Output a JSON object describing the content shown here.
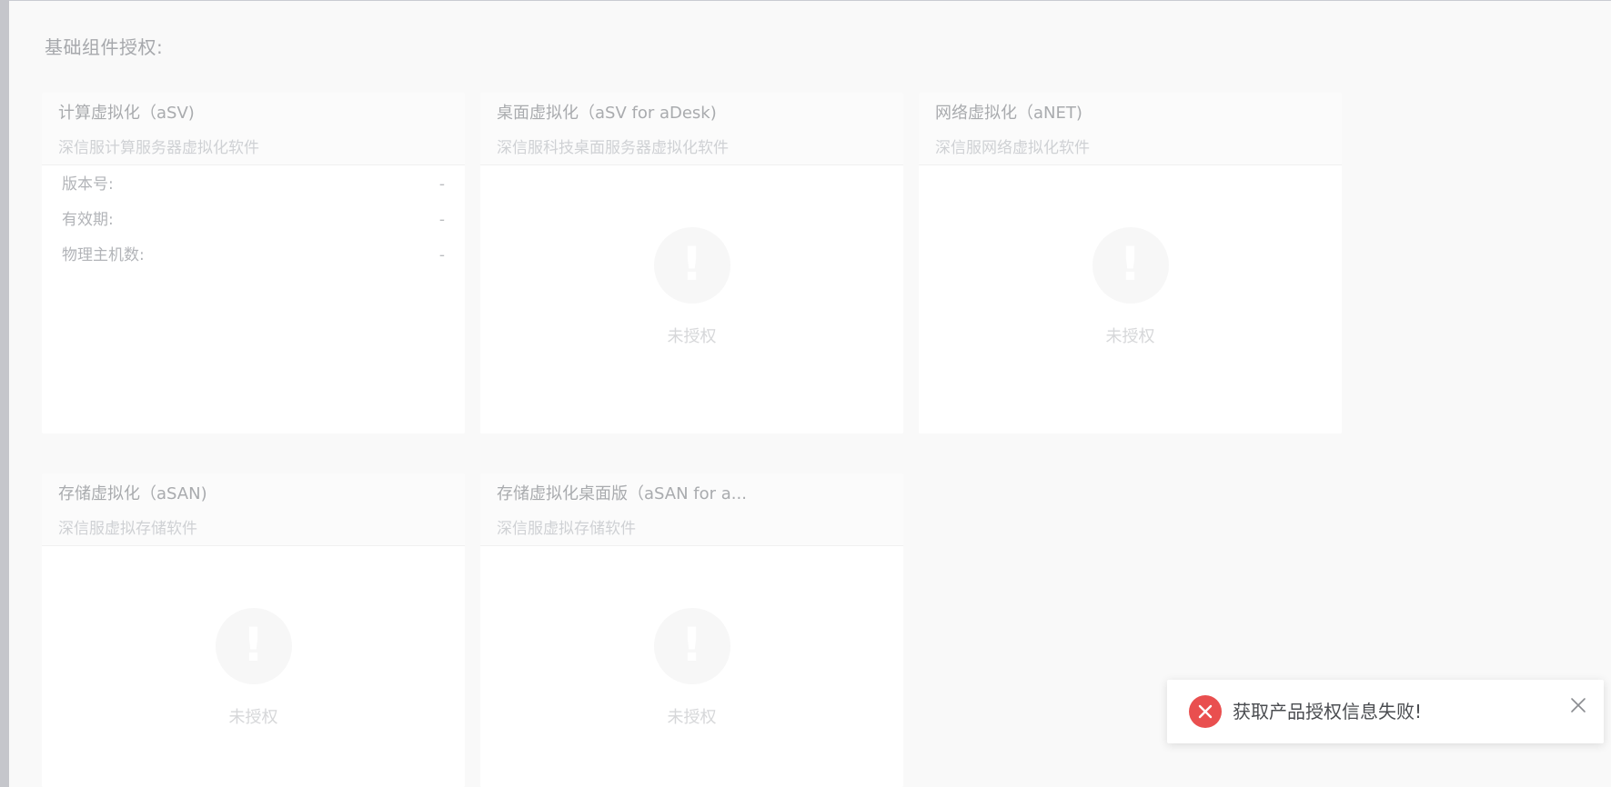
{
  "section": {
    "title": "基础组件授权:"
  },
  "cards": [
    {
      "title": "计算虚拟化（aSV)",
      "subtitle": "深信服计算服务器虚拟化软件",
      "rows": [
        {
          "label": "版本号:",
          "value": "-"
        },
        {
          "label": "有效期:",
          "value": "-"
        },
        {
          "label": "物理主机数:",
          "value": "-"
        }
      ]
    },
    {
      "title": "桌面虚拟化（aSV for aDesk)",
      "subtitle": "深信服科技桌面服务器虚拟化软件",
      "empty_text": "未授权"
    },
    {
      "title": "网络虚拟化（aNET)",
      "subtitle": "深信服网络虚拟化软件",
      "empty_text": "未授权"
    },
    {
      "title": "存储虚拟化（aSAN)",
      "subtitle": "深信服虚拟存储软件",
      "empty_text": "未授权"
    },
    {
      "title": "存储虚拟化桌面版（aSAN for a...",
      "subtitle": "深信服虚拟存储软件",
      "empty_text": "未授权"
    }
  ],
  "toast": {
    "message": "获取产品授权信息失败!",
    "type": "error",
    "icon": "error-circle-icon",
    "color": "#e94f4f"
  },
  "colors": {
    "background": "#f9f9f9",
    "card": "#ffffff",
    "error": "#e94f4f"
  }
}
